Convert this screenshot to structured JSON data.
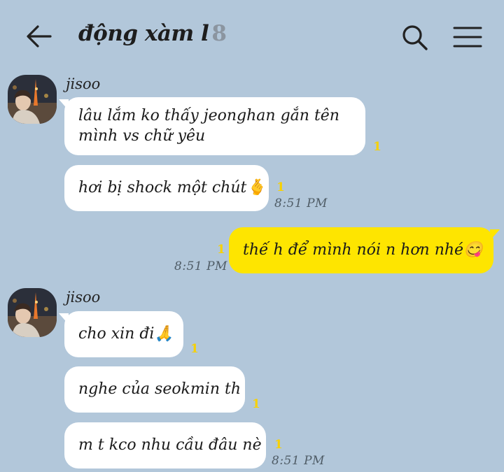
{
  "header": {
    "title": "động xàm l",
    "member_count": "8",
    "back_icon": "arrow-left-icon",
    "search_icon": "search-icon",
    "menu_icon": "hamburger-menu-icon"
  },
  "messages": {
    "group1": {
      "sender": "jisoo",
      "m1_line1": "lâu lắm ko thấy jeonghan gắn tên",
      "m1_line2": "mình vs chữ yêu",
      "m1_unread": "1",
      "m2": "hơi bị shock một chút🫰",
      "m2_unread": "1",
      "m2_time": "8:51 PM"
    },
    "mine": {
      "text": "thế h để mình nói n hơn nhé😋",
      "unread": "1",
      "time": "8:51 PM"
    },
    "group2": {
      "sender": "jisoo",
      "m1": "cho xin đi🙏",
      "m1_unread": "1",
      "m2": "nghe của seokmin th",
      "m2_unread": "1",
      "m3": "m t kco nhu cầu đâu nè",
      "m3_unread": "1",
      "m3_time": "8:51 PM"
    }
  },
  "colors": {
    "background": "#b2c7da",
    "my_bubble": "#fee500",
    "other_bubble": "#ffffff",
    "unread": "#f7d100"
  }
}
